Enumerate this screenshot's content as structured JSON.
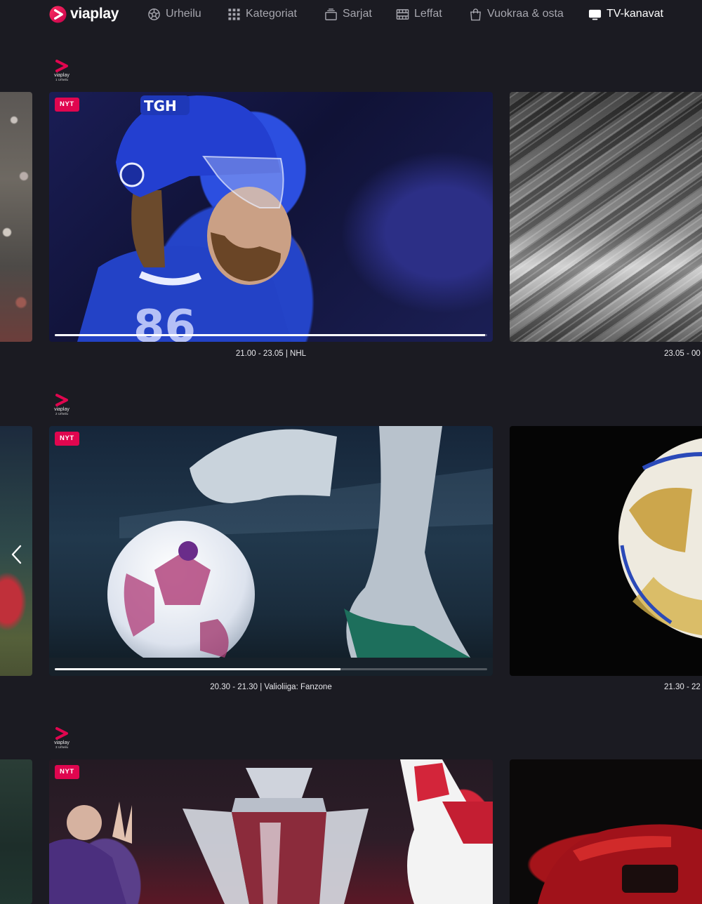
{
  "app": {
    "brand": "viaplay",
    "colors": {
      "background": "#1b1b22",
      "accent": "#e0064f",
      "nav_text": "#a6a6ae",
      "nav_active": "#ffffff"
    }
  },
  "nav": {
    "items": [
      {
        "label": "Urheilu",
        "icon": "football-icon"
      },
      {
        "label": "Kategoriat",
        "icon": "grid-icon"
      },
      {
        "label": "Sarjat",
        "icon": "tv-stack-icon"
      },
      {
        "label": "Leffat",
        "icon": "film-icon"
      },
      {
        "label": "Vuokraa & osta",
        "icon": "shopping-bag-icon"
      },
      {
        "label": "TV-kanavat",
        "icon": "tv-icon",
        "active": true
      }
    ]
  },
  "channels": [
    {
      "logo": {
        "brand": "viaplay",
        "sub": "1 Urheilu"
      },
      "live_badge": "NYT",
      "live_progress": 0.995,
      "now_caption": "21.00 - 23.05 | NHL",
      "next_caption": "23.05 - 00"
    },
    {
      "logo": {
        "brand": "viaplay",
        "sub": "2 Urheilu"
      },
      "live_badge": "NYT",
      "live_progress": 0.66,
      "now_caption": "20.30 - 21.30 | Valioliiga: Fanzone",
      "next_caption": "21.30 - 22"
    },
    {
      "logo": {
        "brand": "viaplay",
        "sub": "3 Urheilu"
      },
      "live_badge": "NYT"
    }
  ]
}
